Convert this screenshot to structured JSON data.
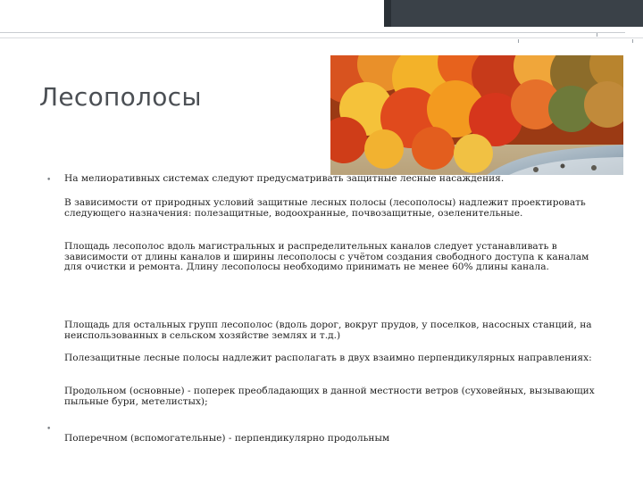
{
  "slide": {
    "title": "Лесополосы",
    "bullet_glyph": "•",
    "paragraphs": [
      "На мелиоративных системах следуют предусматривать защитные лесные насаждения.",
      "В зависимости от природных условий защитные лесных полосы (лесополосы) надлежит проектировать следующего назначения: полезащитные, водоохранные, почвозащитные, озеленительные.",
      "Площадь лесополос вдоль магистральных и распределительных каналов следует устанавливать в зависимости от длины каналов и ширины лесополосы с учётом создания свободного доступа к каналам для очистки и ремонта. Длину лесополосы необходимо принимать не менее 60% длины канала.",
      "Площадь для остальных групп лесополос (вдоль дорог, вокруг прудов, у поселков, насосных станций, на неиспользованных в сельском хозяйстве землях и т.д.)",
      "Полезащитные лесные полосы надлежит располагать в двух взаимно перпендикулярных направлениях:",
      "Продольном (основные) - поперек преобладающих в данной местности ветров (суховейных, вызывающих пыльные бури, метелистых);",
      "Поперечном (вспомогательные) - перпендикулярно продольным"
    ]
  },
  "colors": {
    "title": "#4b4f54",
    "text": "#1e1e1e",
    "header_bar": "#3a4148"
  },
  "image": {
    "subject": "autumn forest with red and orange trees along a river"
  }
}
